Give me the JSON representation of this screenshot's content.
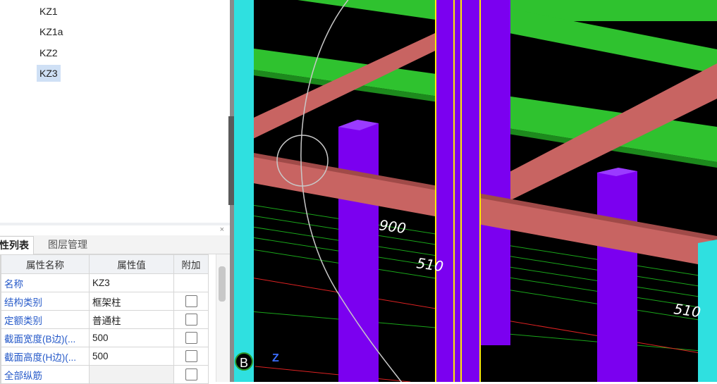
{
  "tree": {
    "items": [
      {
        "label": "KZ1",
        "selected": false
      },
      {
        "label": "KZ1a",
        "selected": false
      },
      {
        "label": "KZ2",
        "selected": false
      },
      {
        "label": "KZ3",
        "selected": true
      }
    ]
  },
  "props": {
    "close_label": "×",
    "tabs": [
      {
        "label": "性列表",
        "active": true
      },
      {
        "label": "图层管理",
        "active": false
      }
    ],
    "headers": {
      "name": "属性名称",
      "value": "属性值",
      "extra": "附加"
    },
    "rows": [
      {
        "name": "名称",
        "value": "KZ3",
        "has_checkbox": false
      },
      {
        "name": "结构类别",
        "value": "框架柱",
        "has_checkbox": true
      },
      {
        "name": "定额类别",
        "value": "普通柱",
        "has_checkbox": true
      },
      {
        "name": "截面宽度(B边)(...",
        "value": "500",
        "has_checkbox": true
      },
      {
        "name": "截面高度(H边)(...",
        "value": "500",
        "has_checkbox": true
      },
      {
        "name": "全部纵筋",
        "value": "",
        "has_checkbox": true
      }
    ]
  },
  "viewport": {
    "dim_labels": [
      "900",
      "510",
      "510"
    ],
    "axis_labels": {
      "b": "B",
      "z": "Z"
    }
  },
  "colors": {
    "column_purple": "#7b00f0",
    "beam_green": "#2fc22f",
    "beam_red": "#c86462",
    "column_cyan": "#2fe0e0",
    "highlight_yellow": "#ffee00"
  }
}
